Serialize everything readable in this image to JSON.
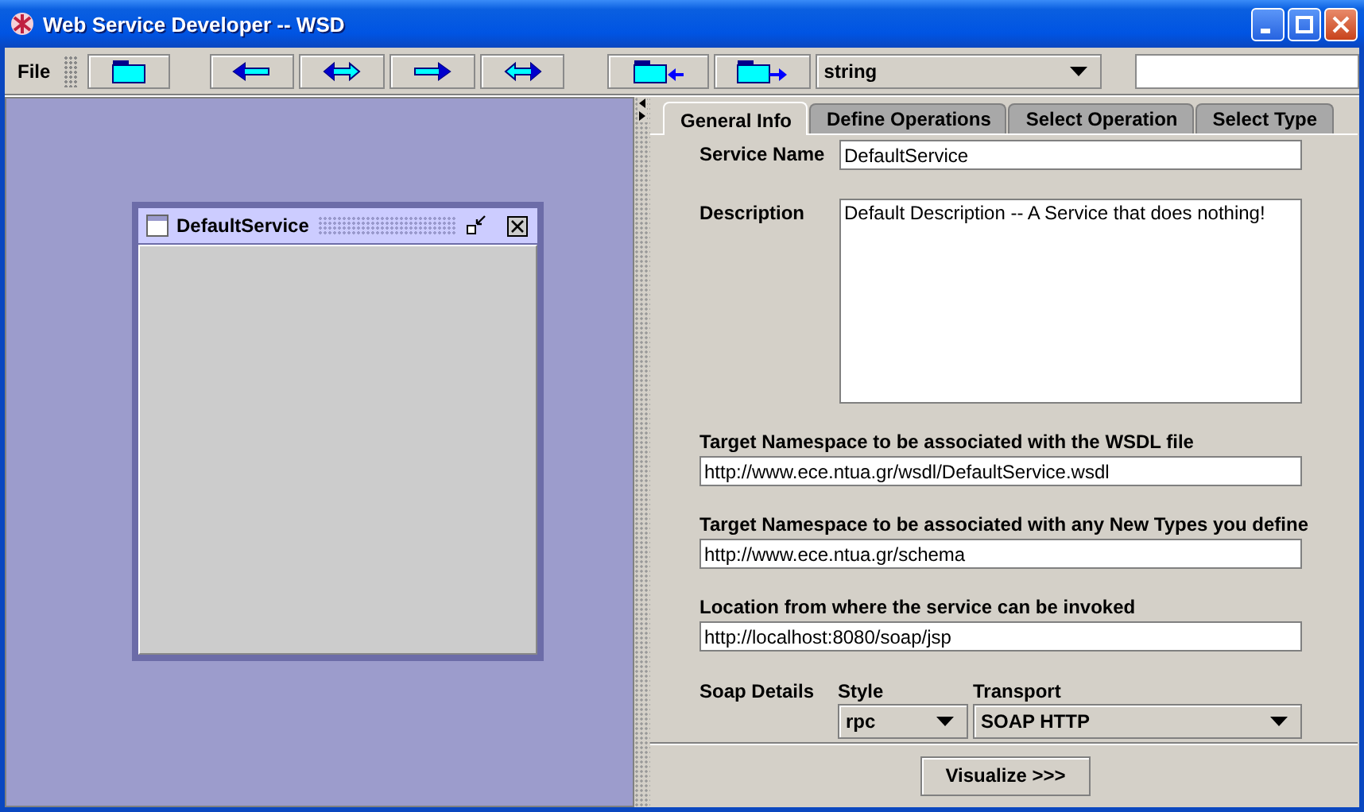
{
  "window": {
    "title": "Web Service Developer -- WSD"
  },
  "toolbar": {
    "menu": "File",
    "buttons": [
      {
        "kind": "folder"
      },
      {
        "kind": "arrow-left"
      },
      {
        "kind": "arrow-both"
      },
      {
        "kind": "arrow-right"
      },
      {
        "kind": "arrow-both-alt"
      },
      {
        "kind": "folder-in"
      },
      {
        "kind": "folder-out"
      }
    ],
    "type_combo": {
      "value": "string"
    }
  },
  "canvas": {
    "frame": {
      "title": "DefaultService"
    }
  },
  "tabs": [
    {
      "label": "General Info",
      "selected": true
    },
    {
      "label": "Define Operations",
      "selected": false
    },
    {
      "label": "Select Operation",
      "selected": false
    },
    {
      "label": "Select Type",
      "selected": false
    }
  ],
  "form": {
    "service_name": {
      "label": "Service Name",
      "value": "DefaultService"
    },
    "description": {
      "label": "Description",
      "value": "Default Description -- A Service that does nothing!"
    },
    "fields": [
      {
        "label": "Target Namespace to be associated with the WSDL file",
        "value": "http://www.ece.ntua.gr/wsdl/DefaultService.wsdl"
      },
      {
        "label": "Target Namespace to be associated with any New Types you define",
        "value": "http://www.ece.ntua.gr/schema"
      },
      {
        "label": "Location from where the service can be invoked",
        "value": "http://localhost:8080/soap/jsp"
      }
    ],
    "soap": {
      "label": "Soap Details",
      "style_label": "Style",
      "style": "rpc",
      "transport_label": "Transport",
      "transport": "SOAP HTTP"
    }
  },
  "visualize_button": "Visualize >>>"
}
